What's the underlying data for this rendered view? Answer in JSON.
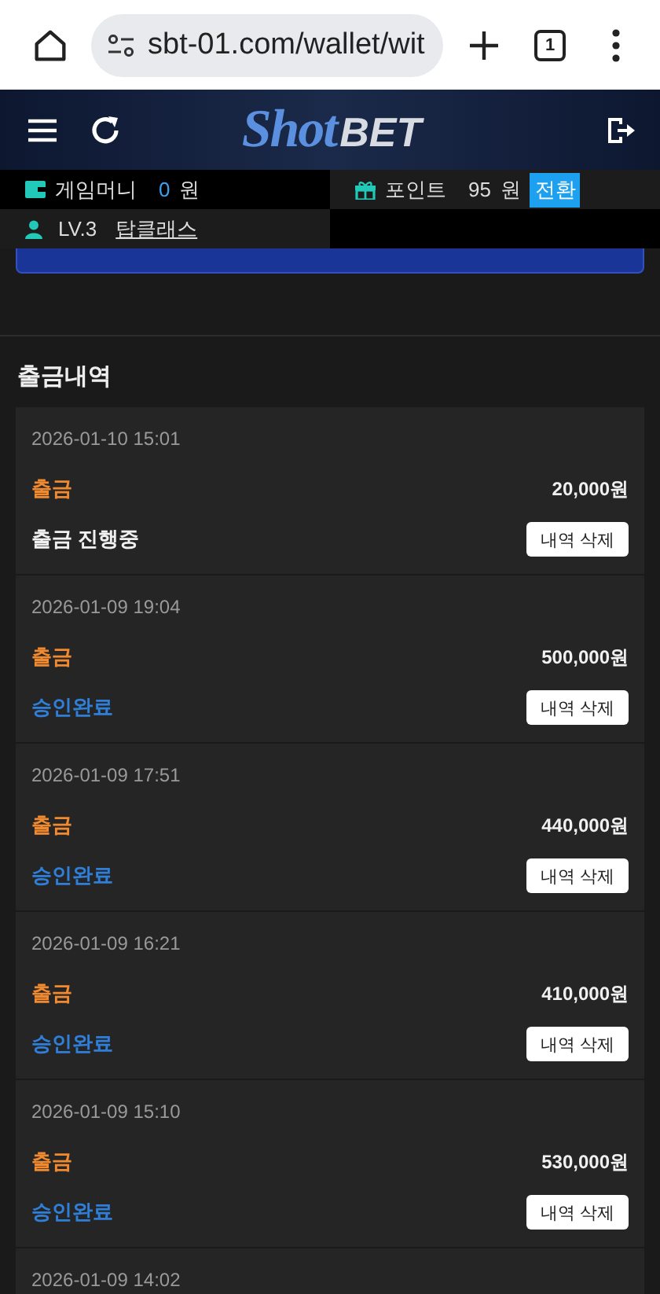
{
  "browser": {
    "url": "sbt-01.com/wallet/wit",
    "tab_count": "1"
  },
  "header": {
    "logo_script": "Shot",
    "logo_bold": "BET"
  },
  "account": {
    "money_label": "게임머니",
    "money_value": "0",
    "money_unit": "원",
    "point_label": "포인트",
    "point_value": "95",
    "point_unit": "원",
    "convert_button": "전환",
    "level": "LV.3",
    "username": "탑클래스"
  },
  "section_title": "출금내역",
  "records": [
    {
      "date": "2026-01-10 15:01",
      "type": "출금",
      "amount": "20,000원",
      "status": "출금 진행중",
      "kind": "pending",
      "delete_button": "내역 삭제"
    },
    {
      "date": "2026-01-09 19:04",
      "type": "출금",
      "amount": "500,000원",
      "status": "승인완료",
      "kind": "approved",
      "delete_button": "내역 삭제"
    },
    {
      "date": "2026-01-09 17:51",
      "type": "출금",
      "amount": "440,000원",
      "status": "승인완료",
      "kind": "approved",
      "delete_button": "내역 삭제"
    },
    {
      "date": "2026-01-09 16:21",
      "type": "출금",
      "amount": "410,000원",
      "status": "승인완료",
      "kind": "approved",
      "delete_button": "내역 삭제"
    },
    {
      "date": "2026-01-09 15:10",
      "type": "출금",
      "amount": "530,000원",
      "status": "승인완료",
      "kind": "approved",
      "delete_button": "내역 삭제"
    },
    {
      "date": "2026-01-09 14:02"
    }
  ]
}
